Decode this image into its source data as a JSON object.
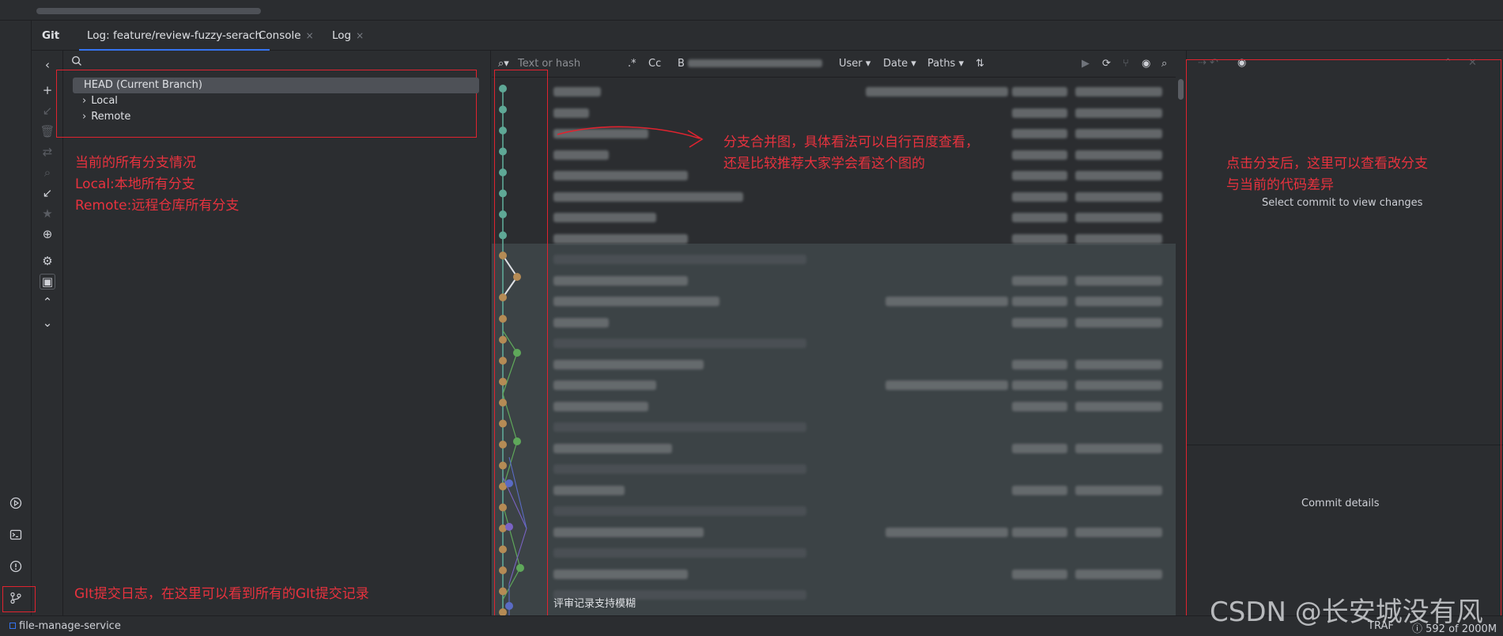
{
  "tabs": {
    "git": "Git",
    "log": "Log: feature/review-fuzzy-serach",
    "console": "Console",
    "log2": "Log",
    "close": "×"
  },
  "branches": {
    "head": "HEAD (Current Branch)",
    "local": "Local",
    "remote": "Remote"
  },
  "log_toolbar": {
    "search_placeholder": "Text or hash",
    "regex": ".*",
    "case": "Cc",
    "branch": "B",
    "user": "User",
    "date": "Date",
    "paths": "Paths"
  },
  "annotations": {
    "branches_line1": "当前的所有分支情况",
    "branches_line2": "Local:本地所有分支",
    "branches_line3": "Remote:远程仓库所有分支",
    "graph_line1": "分支合并图，具体看法可以自行百度查看，",
    "graph_line2": "还是比较推荐大家学会看这个图的",
    "diff_line1": "点击分支后，这里可以查看改分支",
    "diff_line2": "与当前的代码差异",
    "log_hint": "GIt提交日志，在这里可以看到所有的GIt提交记录"
  },
  "details": {
    "select_commit": "Select commit to view changes",
    "commit_details": "Commit details"
  },
  "last_commit": "评审记录支持模糊",
  "status": {
    "project": "file-manage-service",
    "memory": "592 of 2000M",
    "encoding": "TRAF"
  },
  "watermark": "CSDN @长安城没有风",
  "colors": {
    "annotation_red": "#e0232f",
    "graph_teal": "#5fa896",
    "graph_tan": "#b58b55",
    "graph_green": "#5fa85a",
    "graph_purple": "#7a63c4",
    "graph_blue": "#5a6bc4"
  }
}
